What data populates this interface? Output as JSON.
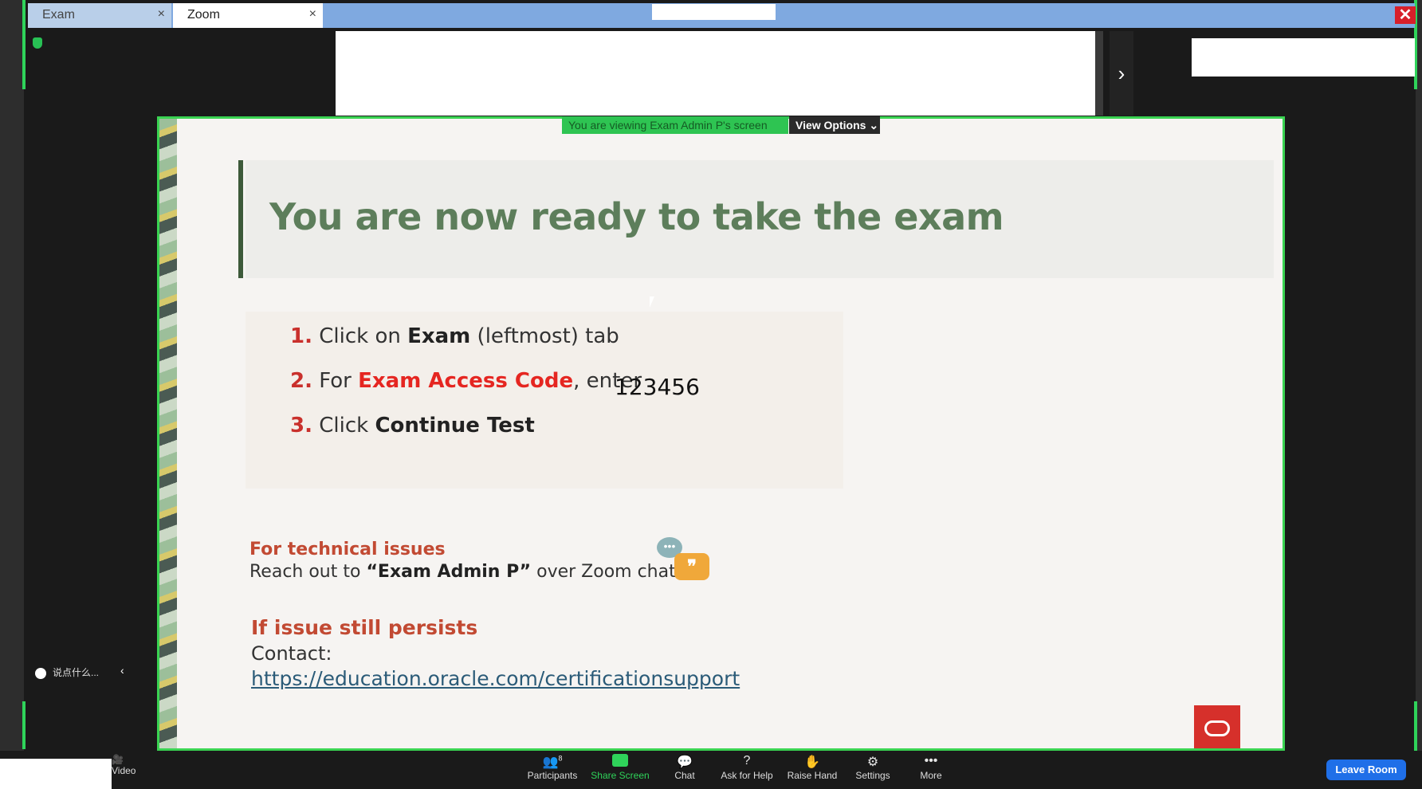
{
  "tabs": [
    {
      "label": "Exam",
      "close": "×"
    },
    {
      "label": "Zoom",
      "close": "×"
    }
  ],
  "window_close": "✕",
  "top_chevron": "›",
  "share_status": {
    "viewing_text": "You are viewing Exam Admin P's screen",
    "view_options": "View Options ⌄"
  },
  "slide": {
    "title": "You are now ready to take the exam",
    "steps": [
      {
        "num": "1.",
        "pre": "Click on ",
        "bold": "Exam",
        "post": " (leftmost) tab"
      },
      {
        "num": "2.",
        "pre": "For ",
        "bold": "Exam Access Code",
        "post": ", enter"
      },
      {
        "num": "3.",
        "pre": "Click ",
        "bold": "Continue Test",
        "post": ""
      }
    ],
    "access_code": "123456",
    "tech_heading": "For technical issues",
    "tech_text_pre": "Reach out to ",
    "tech_text_bold": "“Exam Admin P”",
    "tech_text_post": " over Zoom chat",
    "persist_heading": "If issue still persists",
    "contact_label": "Contact:",
    "support_link": "https://education.oracle.com/certificationsupport"
  },
  "chat_input": {
    "placeholder": "说点什么...",
    "collapse": "‹"
  },
  "toolbar": {
    "video": "Video",
    "participants": "Participants",
    "participants_count": "8",
    "share_screen": "Share Screen",
    "chat": "Chat",
    "ask_for_help": "Ask for Help",
    "raise_hand": "Raise Hand",
    "settings": "Settings",
    "more": "More",
    "leave": "Leave Room"
  }
}
